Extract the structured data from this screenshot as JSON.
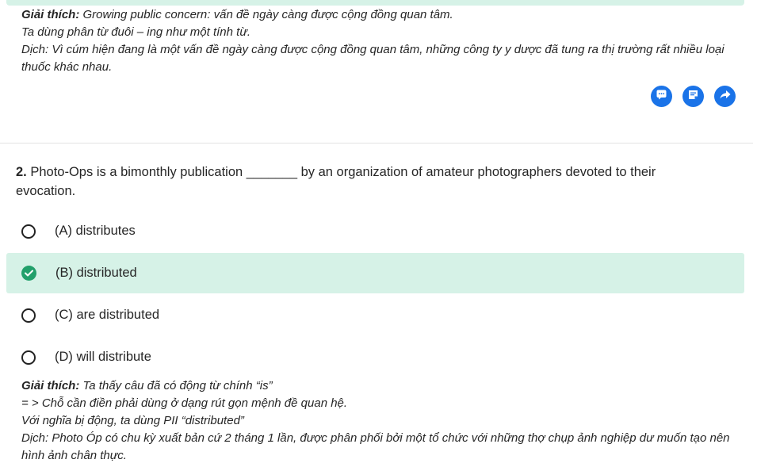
{
  "prev_explanation": {
    "label": "Giải thích:",
    "line1": "Growing public concern: vấn đề ngày càng được cộng đồng quan tâm.",
    "line2": "Ta dùng phân từ đuôi – ing như một tính từ.",
    "line3": "Dịch: Vì cúm hiện đang là một vấn đề ngày càng được cộng đồng quan tâm, những công ty y dược đã tung ra thị trường rất nhiều loại thuốc khác nhau."
  },
  "actions": {
    "icons": [
      "comment-icon",
      "note-icon",
      "share-icon"
    ],
    "color": "#1a73e8"
  },
  "question": {
    "number": "2.",
    "text": "Photo-Ops is a bimonthly publication _______ by an organization of amateur photographers devoted to their evocation."
  },
  "options": [
    {
      "label": "(A) distributes",
      "correct": false
    },
    {
      "label": "(B) distributed",
      "correct": true
    },
    {
      "label": "(C) are distributed",
      "correct": false
    },
    {
      "label": "(D) will distribute",
      "correct": false
    }
  ],
  "explanation": {
    "label": "Giải thích:",
    "line1": "Ta thấy câu đã có động từ chính “is”",
    "line2": "= > Chỗ cần điền phải dùng ở dạng rút gọn mệnh đề quan hệ.",
    "line3": "Với nghĩa bị động, ta dùng PII “distributed”",
    "line4": "Dịch: Photo Óp có chu kỳ xuất bản cứ 2 tháng 1 lần, được phân phối bởi một tổ chức với những thợ chụp ảnh nghiệp dư muốn tạo nên hình ảnh chân thực."
  },
  "colors": {
    "correct_bg": "#d6f2e7",
    "correct_check": "#22a06b",
    "action_blue": "#1a73e8"
  }
}
